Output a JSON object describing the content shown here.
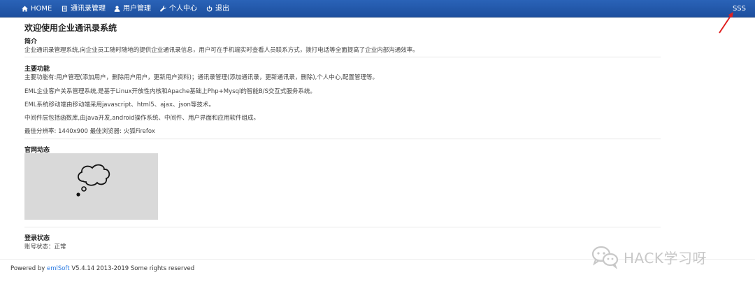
{
  "nav": {
    "items": [
      {
        "label": "HOME",
        "icon": "home-icon"
      },
      {
        "label": "通讯录管理",
        "icon": "book-icon"
      },
      {
        "label": "用户管理",
        "icon": "user-icon"
      },
      {
        "label": "个人中心",
        "icon": "wrench-icon"
      },
      {
        "label": "退出",
        "icon": "power-icon"
      }
    ],
    "right_label": "SSS"
  },
  "main": {
    "title": "欢迎使用企业通讯录系统",
    "intro_title": "简介",
    "intro_text": "企业通讯录管理系统,向企业员工随时随地的提供企业通讯录信息，用户可在手机端实时查看人员联系方式，拨打电话等全面提高了企业内部沟通效率。",
    "features_title": "主要功能",
    "features_lines": [
      "主要功能有:用户管理(添加用户，删除用户用户，更新用户资料)；通讯录管理(添加通讯录，更新通讯录，删除),个人中心,配置管理等。",
      "EML企业客户关系管理系统,是基于Linux开放性内核和Apache基础上Php+Mysql的智能B/S交互式服务系统。",
      "EML系统移动端由移动端采用javascript、html5、ajax、json等技术。",
      "中间件层包括函数库,由java开发,android操作系统、中间件、用户界面和应用软件组成。",
      "最佳分辨率: 1440x900 最佳浏览器: 火狐Firefox"
    ],
    "news_title": "官网动态",
    "status_title": "登录状态",
    "status_text": "账号状态：正常"
  },
  "footer": {
    "prefix": "Powered by ",
    "link": "emlSoft",
    "suffix": " V5.4.14 2013-2019 Some rights reserved"
  },
  "watermark": {
    "text": "HACK学习呀"
  },
  "colors": {
    "navbar": "#1d4f9e",
    "arrow": "#e02020",
    "link": "#2a7ae2"
  }
}
